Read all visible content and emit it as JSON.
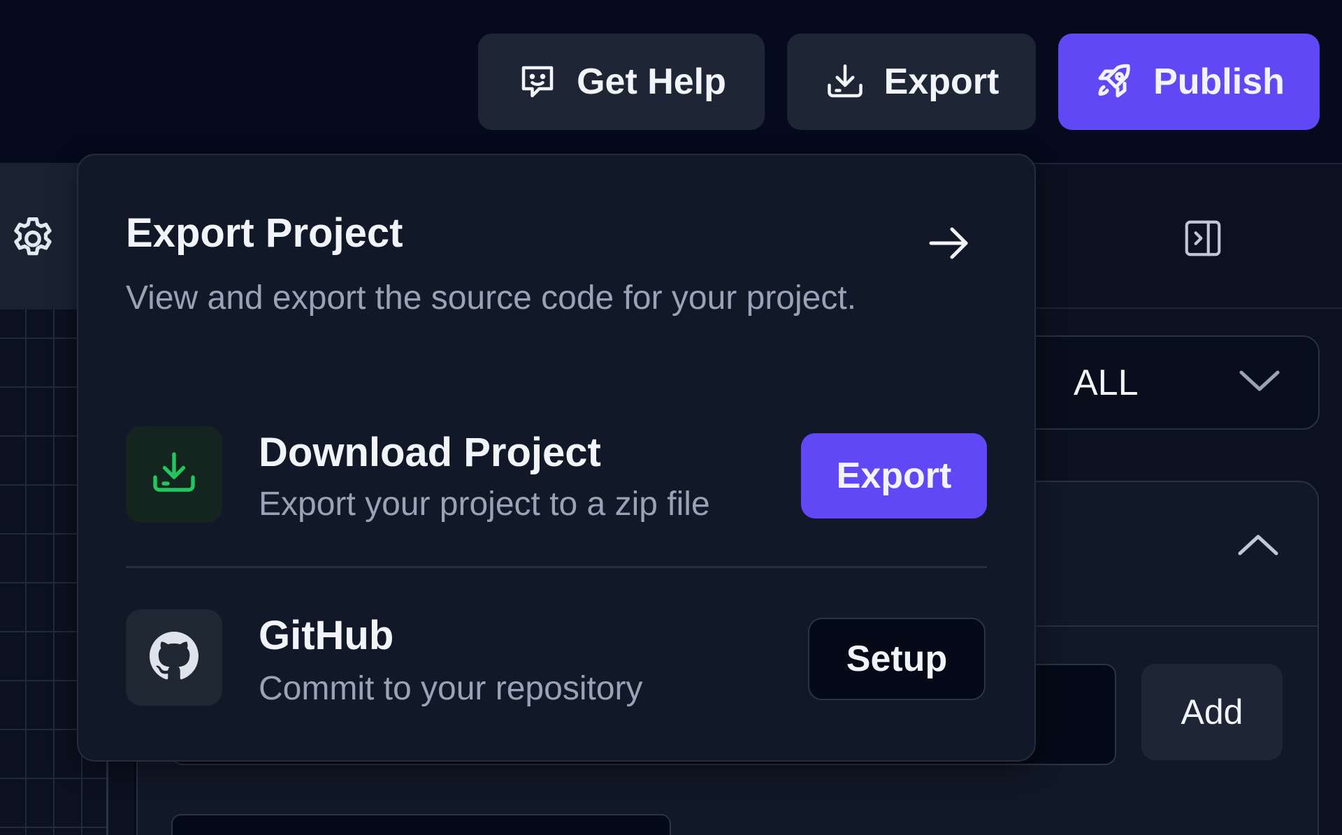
{
  "toolbar": {
    "help_label": "Get Help",
    "help_icon": "chat-smile-icon",
    "export_label": "Export",
    "export_icon": "download-tray-icon",
    "publish_label": "Publish",
    "publish_icon": "rocket-icon"
  },
  "export_popover": {
    "title": "Export Project",
    "description": "View and export the source code for your project.",
    "options": [
      {
        "icon": "download-tray-icon",
        "title": "Download Project",
        "subtitle": "Export your project to a zip file",
        "action_label": "Export"
      },
      {
        "icon": "github-icon",
        "title": "GitHub",
        "subtitle": "Commit to your repository",
        "action_label": "Setup"
      }
    ]
  },
  "right_panel": {
    "filter_value": "ALL",
    "add_label": "Add"
  },
  "colors": {
    "accent": "#6148f7",
    "background": "#050a1c",
    "surface": "#111827",
    "success_icon": "#22c55e"
  }
}
